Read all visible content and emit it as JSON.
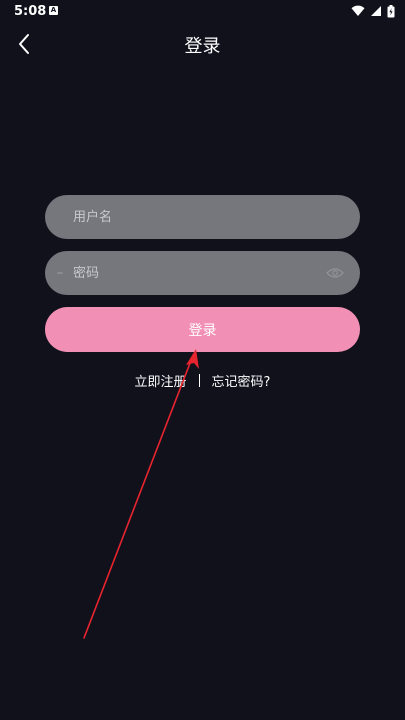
{
  "status_bar": {
    "time": "5:08",
    "notification_badge": "A",
    "icons": [
      "wifi-icon",
      "signal-icon",
      "battery-icon"
    ]
  },
  "header": {
    "title": "登录",
    "back_icon": "chevron-left-icon"
  },
  "form": {
    "username_placeholder": "用户名",
    "username_value": "",
    "password_placeholder": "密码",
    "password_value": "",
    "password_toggle_icon": "eye-icon",
    "submit_label": "登录"
  },
  "links": {
    "register_label": "立即注册",
    "forgot_label": "忘记密码?"
  },
  "colors": {
    "background": "#11111c",
    "field_background": "#76767d",
    "primary_button": "#f190b4",
    "annotation_arrow": "#e8242f"
  }
}
